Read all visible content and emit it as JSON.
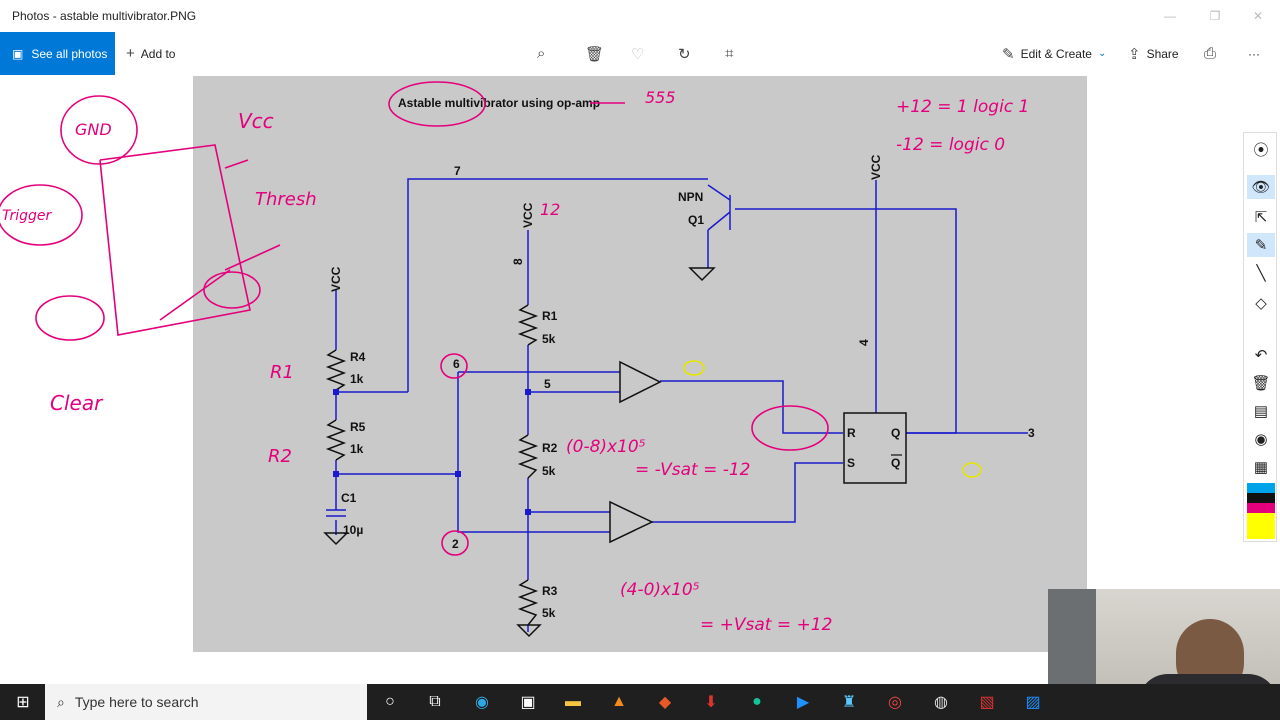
{
  "window": {
    "title": "Photos - astable multivibrator.PNG"
  },
  "toolbar": {
    "see_all": "See all photos",
    "add_to": "Add to",
    "edit_create": "Edit & Create",
    "share": "Share",
    "more": "···"
  },
  "circuit": {
    "title": "Astable multivibrator using op-amp",
    "labels": {
      "n7": "7",
      "vcc_top": "VCC",
      "n8": "8",
      "npn": "NPN",
      "q1": "Q1",
      "vcc_right": "VCC",
      "n4": "4",
      "r1": "R1",
      "r1v": "5k",
      "n5": "5",
      "r2": "R2",
      "r2v": "5k",
      "r3": "R3",
      "r3v": "5k",
      "vcc_left": "VCC",
      "r4": "R4",
      "r4v": "1k",
      "r5": "R5",
      "r5v": "1k",
      "c1": "C1",
      "c1v": "10µ",
      "n6": "6",
      "n2": "2",
      "R": "R",
      "S": "S",
      "Q": "Q",
      "Qb": "Q",
      "n3": "3"
    }
  },
  "annotations": {
    "a1": "555",
    "a2": "+12 = 1 logic 1",
    "a3": "-12 = logic 0",
    "a4": "Vcc",
    "a5": "GND",
    "a6": "Trigger",
    "a7": "Thresh",
    "a8": "Clear",
    "a9": "R1",
    "a10": "R2",
    "a11": "(0-8)x10⁵",
    "a12": "= -Vsat = -12",
    "a13": "(4-0)x10⁵",
    "a14": "= +Vsat = +12",
    "a15": "12"
  },
  "taskbar": {
    "search_placeholder": "Type here to search"
  },
  "colors": {
    "accent": "#0078d7",
    "wire": "#0000cc",
    "ink": "#e4007c",
    "yellow_ink": "#e6e600"
  }
}
